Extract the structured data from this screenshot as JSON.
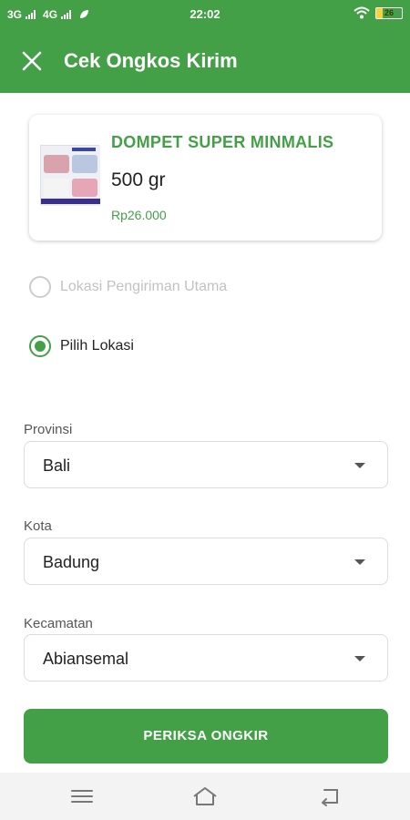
{
  "status_bar": {
    "network1": "3G",
    "network2": "4G",
    "time": "22:02",
    "battery_level": "26",
    "battery_fraction": 0.26
  },
  "app_bar": {
    "title": "Cek Ongkos Kirim",
    "close_icon": "close-icon"
  },
  "product": {
    "name": "DOMPET SUPER MINMALIS",
    "weight": "500 gr",
    "price": "Rp26.000"
  },
  "location_options": [
    {
      "label": "Lokasi Pengiriman Utama",
      "selected": false,
      "disabled": true
    },
    {
      "label": "Pilih Lokasi",
      "selected": true,
      "disabled": false
    }
  ],
  "fields": {
    "provinsi": {
      "label": "Provinsi",
      "value": "Bali"
    },
    "kota": {
      "label": "Kota",
      "value": "Badung"
    },
    "kecamatan": {
      "label": "Kecamatan",
      "value": "Abiansemal"
    }
  },
  "submit_label": "PERIKSA ONGKIR",
  "colors": {
    "primary": "#43a047",
    "disabled": "#c2c2c2"
  },
  "nav_icons": [
    "menu-icon",
    "home-icon",
    "back-icon"
  ]
}
